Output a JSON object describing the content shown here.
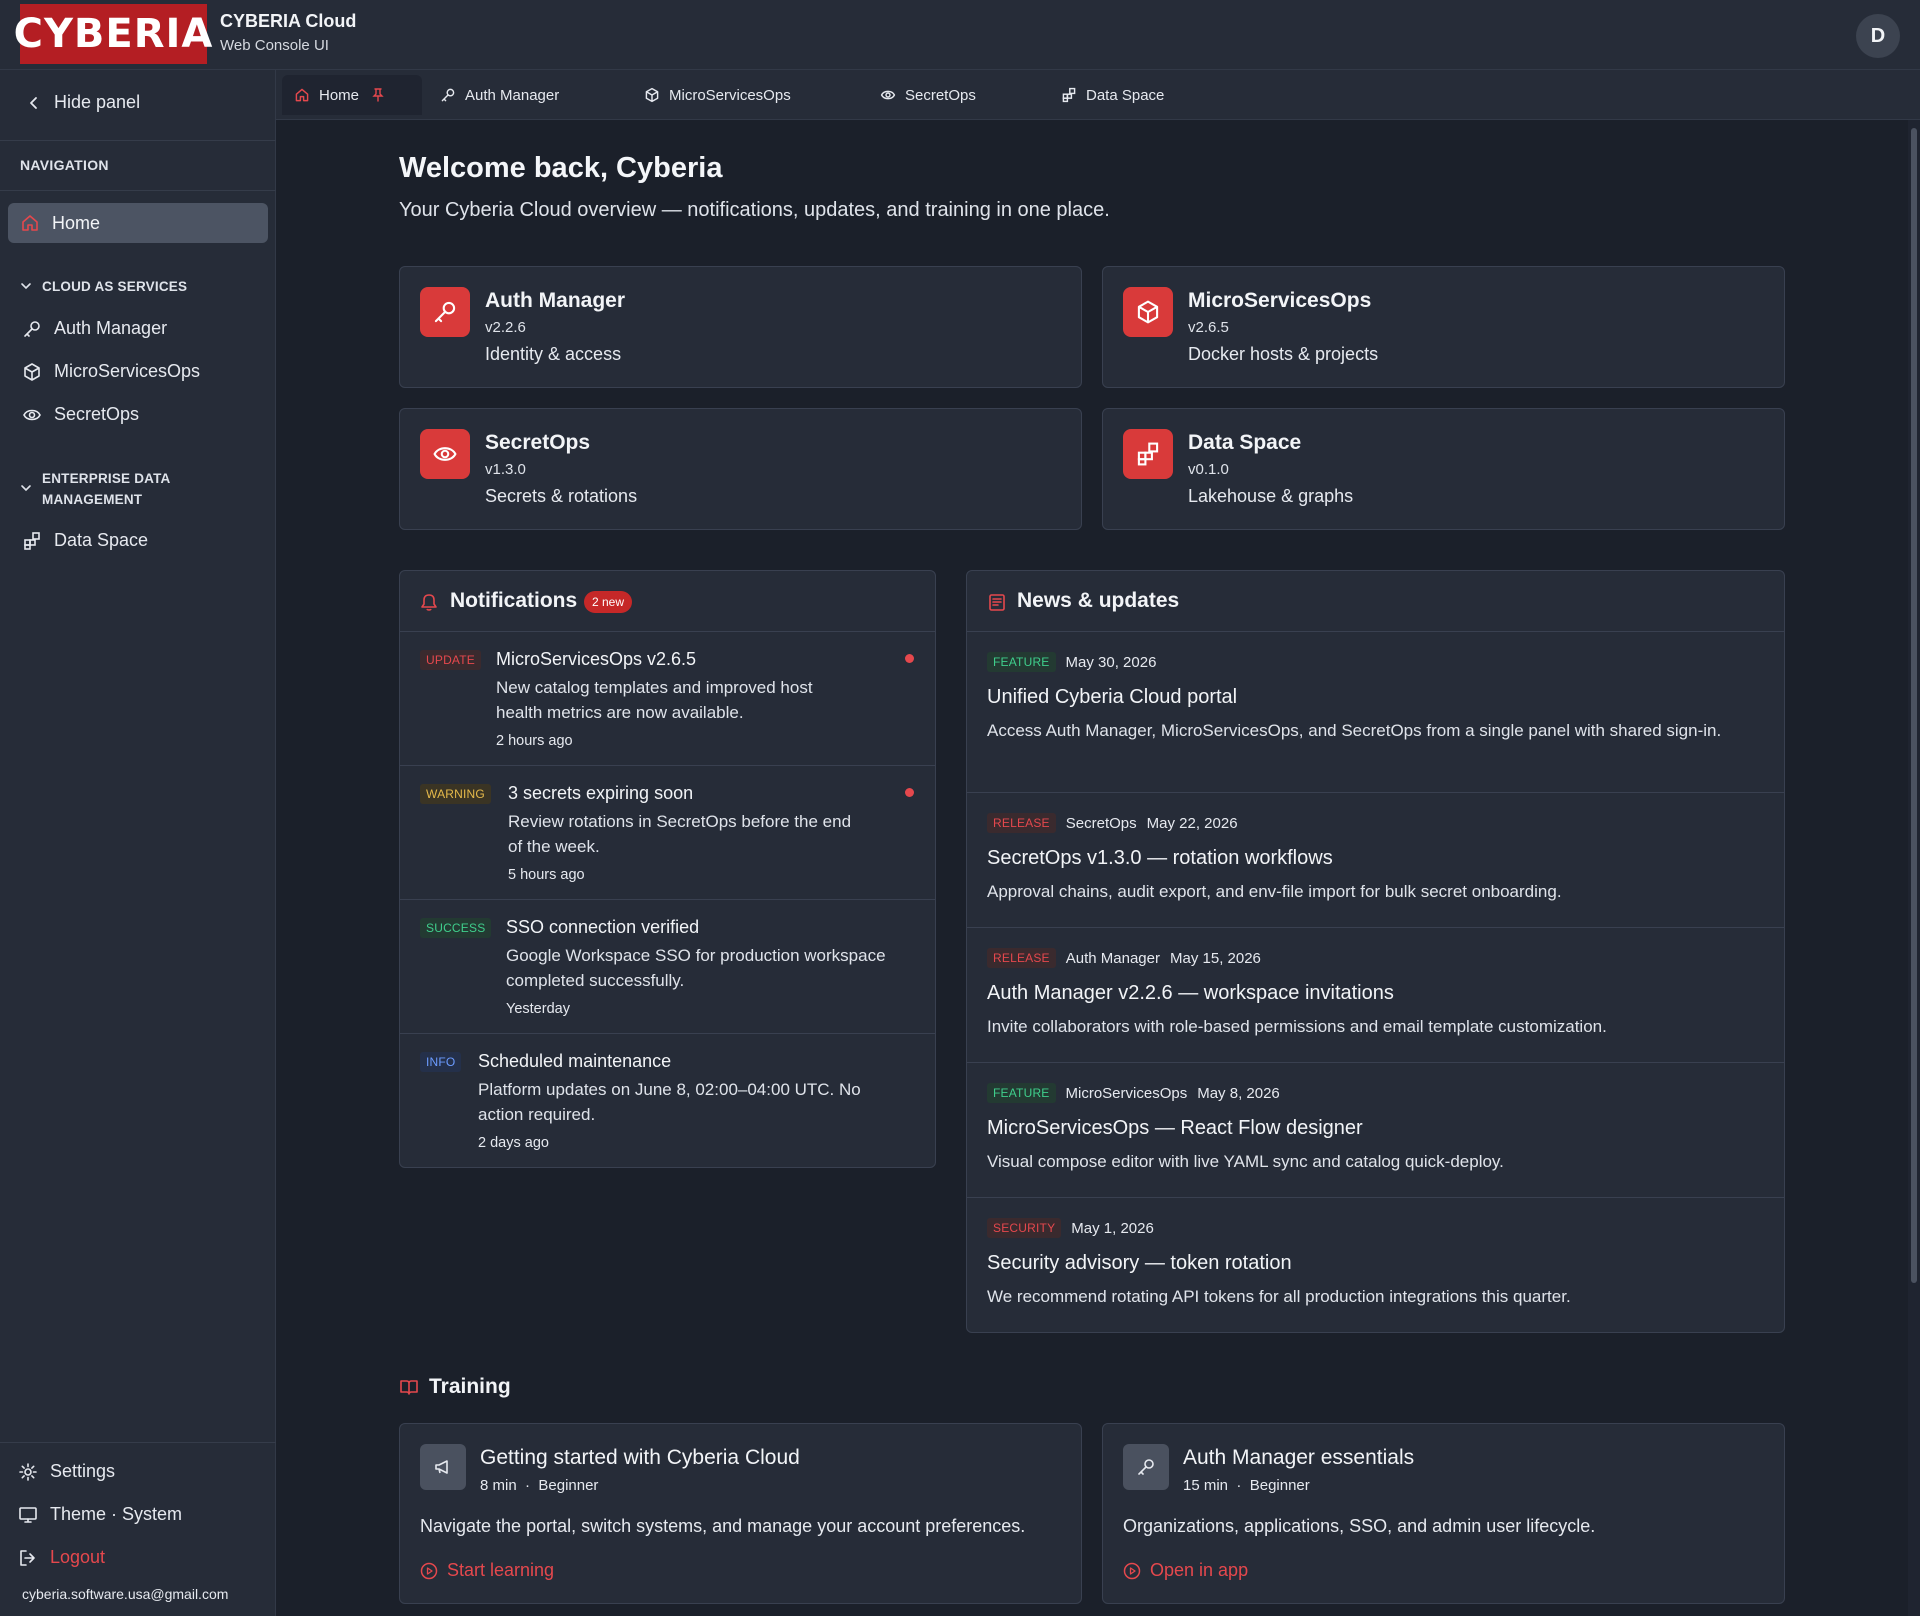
{
  "header": {
    "logo_text": "CYBERIA",
    "app_title": "CYBERIA Cloud",
    "app_subtitle": "Web Console UI",
    "avatar_initial": "D"
  },
  "sidebar": {
    "hide_panel": "Hide panel",
    "navigation_heading": "NAVIGATION",
    "home": "Home",
    "groups": [
      {
        "title": "CLOUD AS SERVICES",
        "items": [
          "Auth Manager",
          "MicroServicesOps",
          "SecretOps"
        ]
      },
      {
        "title_line1": "ENTERPRISE DATA",
        "title_line2": "MANAGEMENT",
        "items": [
          "Data Space"
        ]
      }
    ],
    "settings": "Settings",
    "theme": "Theme · System",
    "logout": "Logout",
    "email": "cyberia.software.usa@gmail.com"
  },
  "tabs": [
    "Home",
    "Auth Manager",
    "MicroServicesOps",
    "SecretOps",
    "Data Space"
  ],
  "welcome": {
    "title": "Welcome back, Cyberia",
    "subtitle": "Your Cyberia Cloud overview — notifications, updates, and training in one place."
  },
  "systems": [
    {
      "name": "Auth Manager",
      "version": "v2.2.6",
      "desc": "Identity & access",
      "icon": "key-icon"
    },
    {
      "name": "MicroServicesOps",
      "version": "v2.6.5",
      "desc": "Docker hosts & projects",
      "icon": "cube-icon"
    },
    {
      "name": "SecretOps",
      "version": "v1.3.0",
      "desc": "Secrets & rotations",
      "icon": "eye-icon"
    },
    {
      "name": "Data Space",
      "version": "v0.1.0",
      "desc": "Lakehouse & graphs",
      "icon": "blocks-icon"
    }
  ],
  "notifications": {
    "title": "Notifications",
    "badge": "2 new",
    "items": [
      {
        "tag": "UPDATE",
        "title": "MicroServicesOps v2.6.5",
        "body_line1": "New catalog templates and improved host",
        "body_line2": "health metrics are now available.",
        "time": "2 hours ago",
        "unread": true
      },
      {
        "tag": "WARNING",
        "title": "3 secrets expiring soon",
        "body_line1": "Review rotations in SecretOps before the end",
        "body_line2": "of the week.",
        "time": "5 hours ago",
        "unread": true
      },
      {
        "tag": "SUCCESS",
        "title": "SSO connection verified",
        "body_line1": "Google Workspace SSO for production workspace",
        "body_line2": "completed successfully.",
        "time": "Yesterday",
        "unread": false
      },
      {
        "tag": "INFO",
        "title": "Scheduled maintenance",
        "body_line1": "Platform updates on June 8, 02:00–04:00 UTC. No",
        "body_line2": "action required.",
        "time": "2 days ago",
        "unread": false
      }
    ]
  },
  "news": {
    "title": "News & updates",
    "items": [
      {
        "tag": "FEATURE",
        "source": "",
        "date": "May 30, 2026",
        "title": "Unified Cyberia Cloud portal",
        "body": "Access Auth Manager, MicroServicesOps, and SecretOps from a single panel with shared sign-in."
      },
      {
        "tag": "RELEASE",
        "source": "SecretOps",
        "date": "May 22, 2026",
        "title": "SecretOps v1.3.0 — rotation workflows",
        "body": "Approval chains, audit export, and env-file import for bulk secret onboarding."
      },
      {
        "tag": "RELEASE",
        "source": "Auth Manager",
        "date": "May 15, 2026",
        "title": "Auth Manager v2.2.6 — workspace invitations",
        "body": "Invite collaborators with role-based permissions and email template customization."
      },
      {
        "tag": "FEATURE",
        "source": "MicroServicesOps",
        "date": "May 8, 2026",
        "title": "MicroServicesOps — React Flow designer",
        "body": "Visual compose editor with live YAML sync and catalog quick-deploy."
      },
      {
        "tag": "SECURITY",
        "source": "",
        "date": "May 1, 2026",
        "title": "Security advisory — token rotation",
        "body": "We recommend rotating API tokens for all production integrations this quarter."
      }
    ]
  },
  "training": {
    "title": "Training",
    "items": [
      {
        "title": "Getting started with Cyberia Cloud",
        "duration": "8 min",
        "level": "Beginner",
        "desc": "Navigate the portal, switch systems, and manage your account preferences.",
        "link": "Start learning",
        "icon": "megaphone-icon"
      },
      {
        "title": "Auth Manager essentials",
        "duration": "15 min",
        "level": "Beginner",
        "desc": "Organizations, applications, SSO, and admin user lifecycle.",
        "link": "Open in app",
        "icon": "key-icon"
      }
    ]
  },
  "colors": {
    "accent": "#d93a3a",
    "background": "#1b202a",
    "panel": "#262c38"
  }
}
